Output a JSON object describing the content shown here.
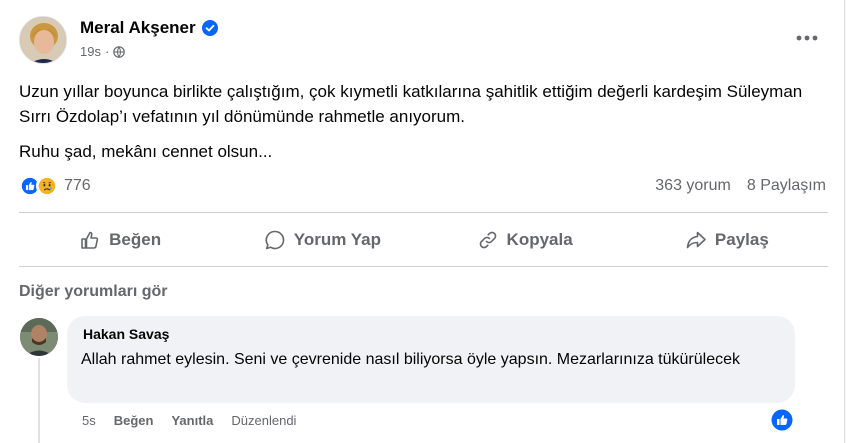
{
  "post": {
    "author": "Meral Akşener",
    "time": "19s",
    "paragraph1": "Uzun yıllar boyunca birlikte çalıştığım, çok kıymetli katkılarına şahitlik ettiğim değerli kardeşim Süleyman Sırrı Özdolap’ı vefatının yıl dönümünde rahmetle anıyorum.",
    "paragraph2": "Ruhu şad, mekânı cennet olsun...",
    "reaction_count": "776",
    "comments_count": "363 yorum",
    "shares_count": "8 Paylaşım"
  },
  "actions": {
    "like": "Beğen",
    "comment": "Yorum Yap",
    "copy": "Kopyala",
    "share": "Paylaş"
  },
  "comments_section": {
    "see_more": "Diğer yorumları gör"
  },
  "comment": {
    "author": "Hakan Savaş",
    "text": "Allah rahmet eylesin. Seni ve çevrenide nasıl biliyorsa öyle yapsın. Mezarlarınıza tükürülecek",
    "time": "5s",
    "like": "Beğen",
    "reply": "Yanıtla",
    "edited": "Düzenlendi"
  },
  "icons": {
    "verified": "verified-badge-icon",
    "privacy": "globe-icon",
    "more": "more-options-icon",
    "like_reaction": "like-reaction-icon",
    "sad_reaction": "sad-reaction-icon"
  },
  "colors": {
    "accent": "#0866ff",
    "secondary_text": "#65676b",
    "bubble": "#f0f2f5"
  }
}
